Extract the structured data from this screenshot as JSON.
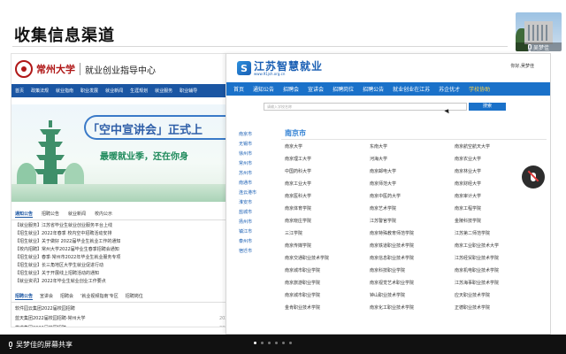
{
  "slide": {
    "title": "收集信息渠道"
  },
  "czu": {
    "name": "常州大学",
    "center": "就业创业指导中心",
    "nav": [
      "首页",
      "政策法规",
      "就业指南",
      "职业发展",
      "就业新闻",
      "生涯规划",
      "就业服务",
      "职业辅导"
    ],
    "banner_title": "「空中宣讲会」正式上",
    "banner_sub": "最暖就业季，还在你身",
    "tabs1": [
      "通知公告",
      "招聘公告",
      "就业新闻",
      "校内公示"
    ],
    "list1": [
      "【就业服务】江苏省毕业生就业创业服务平台上线",
      "【招生就业】2022年春季 校内空中招聘活动安排",
      "【招生就业】关于做好 2022届毕业生就业工作的通知",
      "【校内招聘】常州大学2022届毕业生春季招聘会通知",
      "【招生就业】春季·常州市2022年毕业生就业服务专项",
      "【招生就业】长三角地区大学生就业促进行动",
      "【招生就业】关于开展线上招聘活动的通知",
      "【就业资讯】2022年毕业生就业创业工作要点"
    ],
    "tabs2": [
      "招聘公告",
      "宣讲会",
      "招聘会",
      "'就业视频指南'专区",
      "招聘岗位"
    ],
    "list2": [
      {
        "text": "软件园云集团2022届校园招聘",
        "date": ""
      },
      {
        "text": "蓝天集团2022届校园招聘-常州大学",
        "date": "2022-04-26"
      },
      {
        "text": "横盛集团2022届校园招聘",
        "date": "2022-04-25"
      },
      {
        "text": "",
        "date": "2022-04-25"
      }
    ]
  },
  "js": {
    "logo_text": "江苏智慧就业",
    "logo_url": "www.91jsh.org.cn",
    "user": "你好,吴梦佳",
    "nav": [
      "首页",
      "通知公告",
      "招聘会",
      "宣讲会",
      "招聘岗位",
      "招聘公告",
      "就业创业在江苏",
      "苏企优才",
      "学校协助"
    ],
    "nav_active_index": 8,
    "search_placeholder": "请输入学校名称",
    "search_button": "搜索",
    "cities": [
      "南京市",
      "无锡市",
      "徐州市",
      "常州市",
      "苏州市",
      "南通市",
      "连云港市",
      "淮安市",
      "盐城市",
      "扬州市",
      "镇江市",
      "泰州市",
      "宿迁市"
    ],
    "city_title": "南京市",
    "schools": [
      "南京大学",
      "东南大学",
      "南京航空航天大学",
      "南京理工大学",
      "河海大学",
      "南京农业大学",
      "中国药科大学",
      "南京邮电大学",
      "南京林业大学",
      "南京工业大学",
      "南京师范大学",
      "南京财经大学",
      "南京医科大学",
      "南京中医药大学",
      "南京审计大学",
      "南京体育学院",
      "南京艺术学院",
      "南京工程学院",
      "南京晓庄学院",
      "江苏警官学院",
      "金陵科技学院",
      "三江学院",
      "南京特殊教育师范学院",
      "江苏第二师范学院",
      "南京传媒学院",
      "南京铁道职业技术学院",
      "南京工业职业技术大学",
      "南京交通职业技术学院",
      "南京信息职业技术学院",
      "江苏经贸职业技术学院",
      "南京城市职业学院",
      "南京科技职业学院",
      "南京机电职业技术学院",
      "南京旅游职业学院",
      "南京视觉艺术职业学院",
      "江苏海事职业技术学院",
      "南京城市职业学院",
      "钟山职业技术学院",
      "应天职业技术学院",
      "金肯职业技术学院",
      "南京化工职业技术学院",
      "正德职业技术学院"
    ]
  },
  "participant": {
    "name": "吴梦佳"
  },
  "share": {
    "text": "吴梦佳的屏幕共享"
  },
  "pager": {
    "count": 6,
    "active_index": 0
  }
}
